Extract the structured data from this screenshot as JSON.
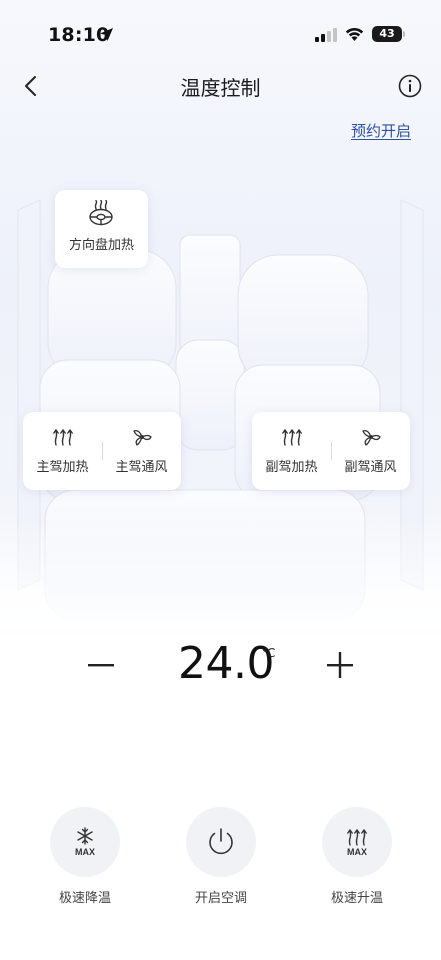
{
  "status_bar": {
    "time": "18:10",
    "battery": "43"
  },
  "header": {
    "title": "温度控制",
    "back_icon": "chevron-left-icon",
    "info_icon": "info-icon"
  },
  "schedule_link": "预约开启",
  "steering": {
    "label": "方向盘加热",
    "icon": "steering-heat-icon"
  },
  "driver": {
    "heat_label": "主驾加热",
    "heat_icon": "heat-waves-icon",
    "vent_label": "主驾通风",
    "vent_icon": "fan-icon"
  },
  "passenger": {
    "heat_label": "副驾加热",
    "heat_icon": "heat-waves-icon",
    "vent_label": "副驾通风",
    "vent_icon": "fan-icon"
  },
  "temperature": {
    "value": "24.0",
    "unit": "℃"
  },
  "actions": [
    {
      "label": "极速降温",
      "icon": "snowflake-max-icon"
    },
    {
      "label": "开启空调",
      "icon": "power-icon"
    },
    {
      "label": "极速升温",
      "icon": "heat-max-icon"
    }
  ],
  "colors": {
    "accent_link": "#2f4fa3",
    "card_bg": "#ffffff",
    "action_circle": "#f1f2f5"
  }
}
